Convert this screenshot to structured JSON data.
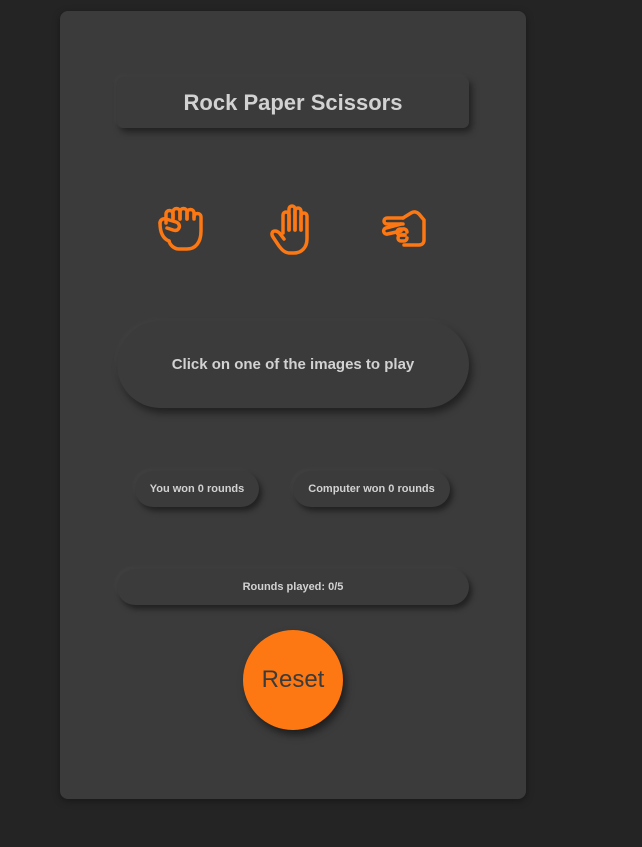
{
  "game": {
    "title": "Rock Paper Scissors",
    "accent_color": "#fd7812",
    "choices": [
      {
        "name": "rock",
        "icon": "fist-icon"
      },
      {
        "name": "paper",
        "icon": "open-hand-icon"
      },
      {
        "name": "scissors",
        "icon": "scissors-hand-icon"
      }
    ],
    "message": "Click on one of the images to play",
    "score": {
      "user": "You won 0 rounds",
      "computer": "Computer won 0 rounds"
    },
    "rounds": "Rounds played: 0/5",
    "reset_label": "Reset"
  }
}
